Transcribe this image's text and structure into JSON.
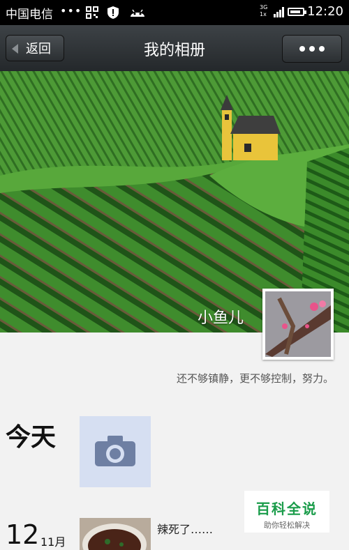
{
  "status_bar": {
    "carrier": "中国电信",
    "dots": "•••",
    "network": "3G",
    "network_sub": "1x",
    "time": "12:20",
    "battery_level": 0.85
  },
  "nav": {
    "back_label": "返回",
    "title": "我的相册"
  },
  "profile": {
    "name": "小鱼儿",
    "signature": "还不够镇静，更不够控制，努力。"
  },
  "feed": {
    "today_label": "今天",
    "entries": [
      {
        "day": "12",
        "month": "11月",
        "text": "辣死了……"
      }
    ]
  },
  "watermark": {
    "title": "百科全说",
    "subtitle": "助你轻松解决"
  },
  "colors": {
    "nav_bg": "#2b2f32",
    "page_bg": "#f2f2f2",
    "camera_tile_bg": "#d6dff2",
    "watermark_green": "#1a9c4a"
  }
}
